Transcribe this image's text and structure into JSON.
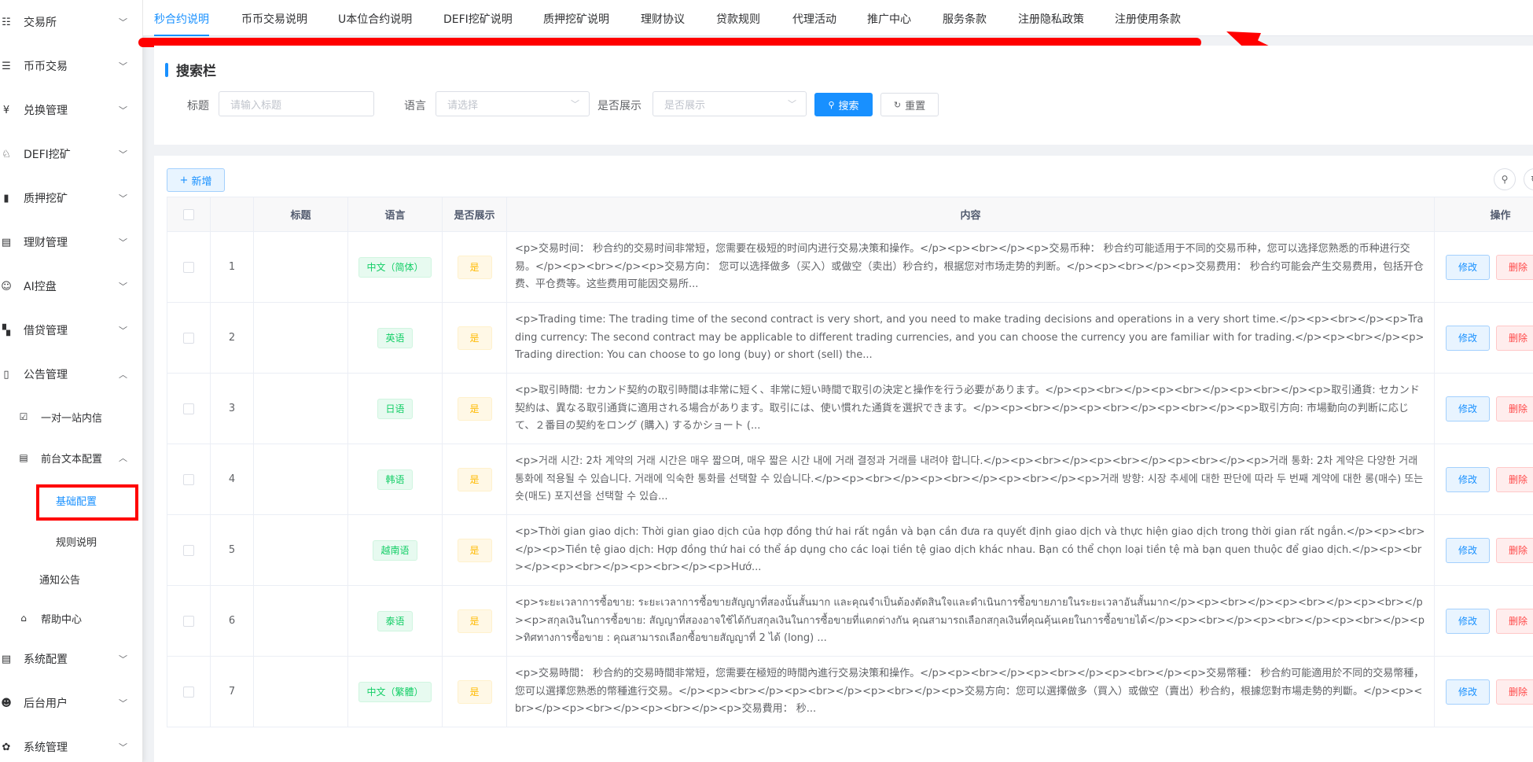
{
  "sidebar": {
    "items": [
      {
        "label": "交易所"
      },
      {
        "label": "币币交易"
      },
      {
        "label": "兑换管理"
      },
      {
        "label": "DEFI挖矿"
      },
      {
        "label": "质押挖矿"
      },
      {
        "label": "理财管理"
      },
      {
        "label": "AI控盘"
      },
      {
        "label": "借贷管理"
      },
      {
        "label": "公告管理"
      },
      {
        "label": "一对一站内信"
      },
      {
        "label": "前台文本配置"
      },
      {
        "label": "基础配置"
      },
      {
        "label": "规则说明"
      },
      {
        "label": "通知公告"
      },
      {
        "label": "帮助中心"
      },
      {
        "label": "系统配置"
      },
      {
        "label": "后台用户"
      },
      {
        "label": "系统管理"
      }
    ]
  },
  "tabs": [
    {
      "label": "秒合约说明"
    },
    {
      "label": "币币交易说明"
    },
    {
      "label": "U本位合约说明"
    },
    {
      "label": "DEFI挖矿说明"
    },
    {
      "label": "质押挖矿说明"
    },
    {
      "label": "理财协议"
    },
    {
      "label": "贷款规则"
    },
    {
      "label": "代理活动"
    },
    {
      "label": "推广中心"
    },
    {
      "label": "服务条款"
    },
    {
      "label": "注册隐私政策"
    },
    {
      "label": "注册使用条款"
    }
  ],
  "search": {
    "title": "搜索栏",
    "title_label": "标题",
    "title_placeholder": "请输入标题",
    "lang_label": "语言",
    "lang_placeholder": "请选择",
    "show_label": "是否展示",
    "show_placeholder": "是否展示",
    "search_btn": "搜索",
    "reset_btn": "重置"
  },
  "toolbar": {
    "add_btn": "新增"
  },
  "table": {
    "headers": {
      "title": "标题",
      "lang": "语言",
      "show": "是否展示",
      "content": "内容",
      "ops": "操作"
    },
    "edit_label": "修改",
    "delete_label": "删除",
    "rows": [
      {
        "idx": "1",
        "lang": "中文（简体）",
        "show": "是",
        "content": "<p>交易时间： 秒合约的交易时间非常短，您需要在极短的时间内进行交易决策和操作。</p><p><br></p><p>交易币种： 秒合约可能适用于不同的交易币种，您可以选择您熟悉的币种进行交易。</p><p><br></p><p>交易方向： 您可以选择做多（买入）或做空（卖出）秒合约，根据您对市场走势的判断。</p><p><br></p><p>交易费用： 秒合约可能会产生交易费用，包括开仓费、平仓费等。这些费用可能因交易所..."
      },
      {
        "idx": "2",
        "lang": "英语",
        "show": "是",
        "content": "<p>Trading time: The trading time of the second contract is very short, and you need to make trading decisions and operations in a very short time.</p><p><br></p><p>Trading currency: The second contract may be applicable to different trading currencies, and you can choose the currency you are familiar with for trading.</p><p><br></p><p>Trading direction: You can choose to go long (buy) or short (sell) the..."
      },
      {
        "idx": "3",
        "lang": "日语",
        "show": "是",
        "content": "<p>取引時間: セカンド契約の取引時間は非常に短く、非常に短い時間で取引の決定と操作を行う必要があります。</p><p><br></p><p><br></p><p><br></p><p>取引通貨: セカンド契約は、異なる取引通貨に適用される場合があります。取引には、使い慣れた通貨を選択できます。</p><p><br></p><p><br></p><p><br></p><p>取引方向: 市場動向の判断に応じて、２番目の契約をロング (購入) するかショート (..."
      },
      {
        "idx": "4",
        "lang": "韩语",
        "show": "是",
        "content": "<p>거래 시간: 2차 계약의 거래 시간은 매우 짧으며, 매우 짧은 시간 내에 거래 결정과 거래를 내려야 합니다.</p><p><br></p><p><br></p><p><br></p><p>거래 통화: 2차 계약은 다양한 거래 통화에 적용될 수 있습니다. 거래에 익숙한 통화를 선택할 수 있습니다.</p><p><br></p><p><br></p><p><br></p><p>거래 방향: 시장 추세에 대한 판단에 따라 두 번째 계약에 대한 롱(매수) 또는 숏(매도) 포지션을 선택할 수 있습..."
      },
      {
        "idx": "5",
        "lang": "越南语",
        "show": "是",
        "content": "<p>Thời gian giao dịch: Thời gian giao dịch của hợp đồng thứ hai rất ngắn và bạn cần đưa ra quyết định giao dịch và thực hiện giao dịch trong thời gian rất ngắn.</p><p><br></p><p>Tiền tệ giao dịch: Hợp đồng thứ hai có thể áp dụng cho các loại tiền tệ giao dịch khác nhau. Bạn có thể chọn loại tiền tệ mà bạn quen thuộc để giao dịch.</p><p><br></p><p><br></p><p><br></p><p>Hướ..."
      },
      {
        "idx": "6",
        "lang": "泰语",
        "show": "是",
        "content": "<p>ระยะเวลาการซื้อขาย: ระยะเวลาการซื้อขายสัญญาที่สองนั้นสั้นมาก และคุณจำเป็นต้องตัดสินใจและดำเนินการซื้อขายภายในระยะเวลาอันสั้นมาก</p><p><br></p><p><br></p><p><br></p><p>สกุลเงินในการซื้อขาย: สัญญาที่สองอาจใช้ได้กับสกุลเงินในการซื้อขายที่แตกต่างกัน คุณสามารถเลือกสกุลเงินที่คุณคุ้นเคยในการซื้อขายได้</p><p><br></p><p><br></p><p><br></p><p>ทิศทางการซื้อขาย : คุณสามารถเลือกซื้อขายสัญญาที่ 2 ได้ (long) ..."
      },
      {
        "idx": "7",
        "lang": "中文（繁體）",
        "show": "是",
        "content": "<p>交易時間： 秒合約的交易時間非常短，您需要在極短的時間內進行交易決策和操作。</p><p><br></p><p><br></p><p><br></p><p>交易幣種： 秒合約可能適用於不同的交易幣種，您可以選擇您熟悉的幣種進行交易。</p><p><br></p><p><br></p><p><br></p><p>交易方向：您可以選擇做多（買入）或做空（賣出）秒合約，根據您對市場走勢的判斷。</p><p><br></p><p><br></p><p><br></p><p>交易費用： 秒..."
      }
    ]
  },
  "colors": {
    "accent": "#1890ff",
    "annotation": "#ff0000",
    "success": "#13ce66",
    "warning": "#ffba00",
    "danger": "#ff4949"
  }
}
